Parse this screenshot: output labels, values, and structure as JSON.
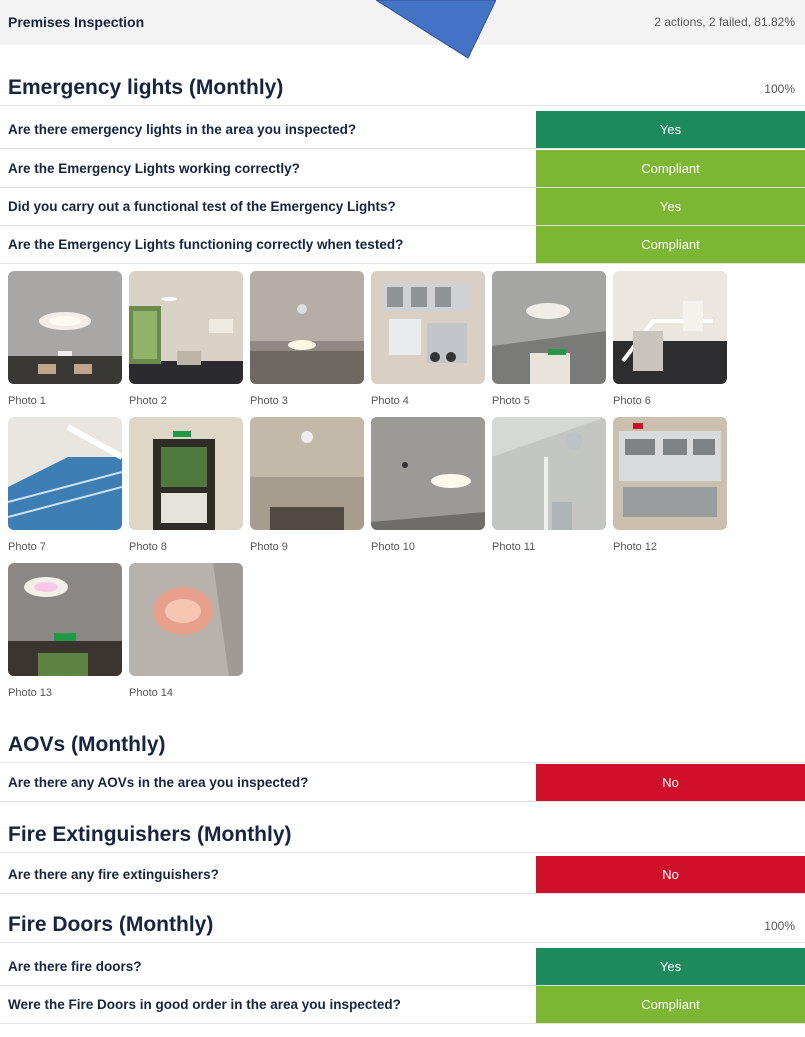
{
  "header": {
    "title": "Premises Inspection",
    "summary": "2 actions, 2 failed, 81.82%"
  },
  "sections": [
    {
      "title": "Emergency lights (Monthly)",
      "percent": "100%",
      "questions": [
        {
          "text": "Are there emergency lights in the area you inspected?",
          "answer": "Yes"
        },
        {
          "text": "Are the Emergency Lights working correctly?",
          "answer": "Compliant"
        },
        {
          "text": "Did you carry out a functional test of the Emergency Lights?",
          "answer": "Yes"
        },
        {
          "text": "Are the Emergency Lights functioning correctly when tested?",
          "answer": "Compliant"
        }
      ],
      "photos": [
        "Photo 1",
        "Photo 2",
        "Photo 3",
        "Photo 4",
        "Photo 5",
        "Photo 6",
        "Photo 7",
        "Photo 8",
        "Photo 9",
        "Photo 10",
        "Photo 11",
        "Photo 12",
        "Photo 13",
        "Photo 14"
      ]
    },
    {
      "title": "AOVs (Monthly)",
      "percent": "",
      "questions": [
        {
          "text": "Are there any AOVs in the area you inspected?",
          "answer": "No"
        }
      ]
    },
    {
      "title": "Fire Extinguishers (Monthly)",
      "percent": "",
      "questions": [
        {
          "text": "Are there any fire extinguishers?",
          "answer": "No"
        }
      ]
    },
    {
      "title": "Fire Doors (Monthly)",
      "percent": "100%",
      "questions": [
        {
          "text": "Are there fire doors?",
          "answer": "Yes"
        },
        {
          "text": "Were the Fire Doors in good order in the area you inspected?",
          "answer": "Compliant"
        }
      ]
    }
  ],
  "colors": {
    "yes": "#1c8a5c",
    "compliant": "#7cb632",
    "no": "#d0102a",
    "arrow": "#4472c4"
  }
}
